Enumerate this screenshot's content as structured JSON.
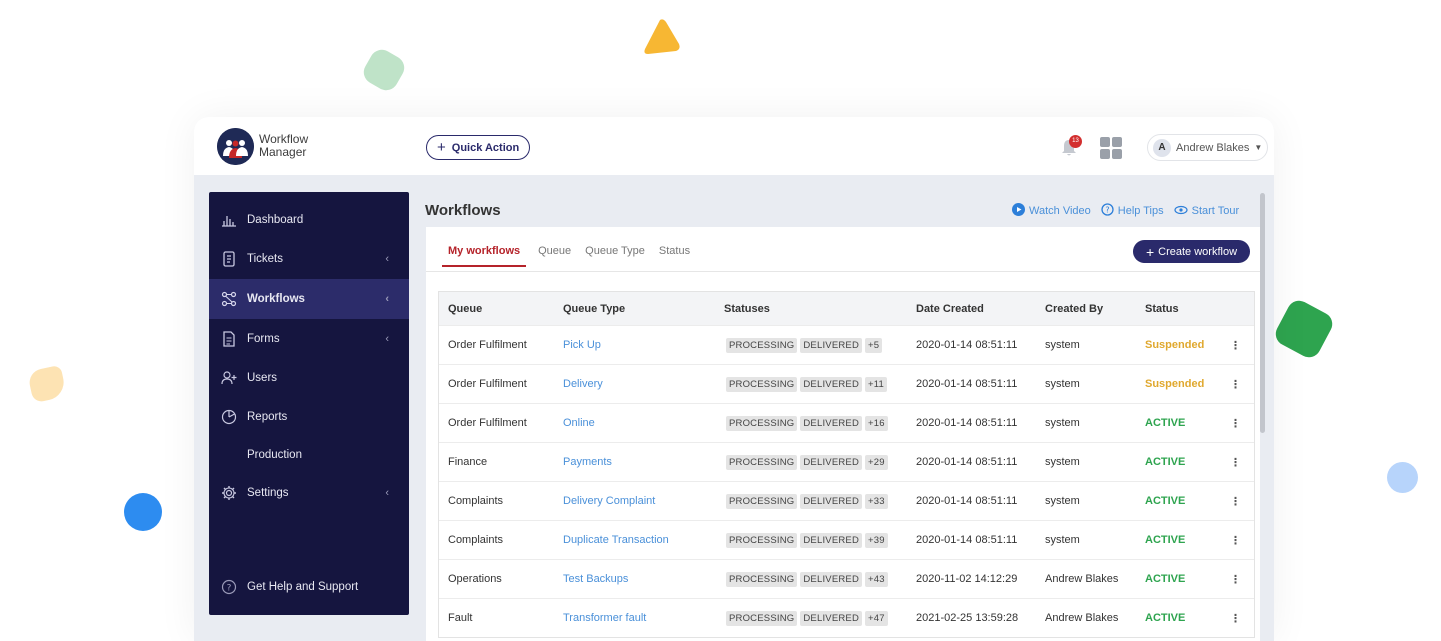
{
  "app": {
    "logo_line1": "Workflow",
    "logo_line2": "Manager",
    "quick_action_label": "Quick Action",
    "notification_count": "13",
    "user_name": "Andrew Blakes",
    "user_initial": "A"
  },
  "sidebar": {
    "items": [
      {
        "label": "Dashboard",
        "icon": "bar-chart-icon"
      },
      {
        "label": "Tickets",
        "icon": "ticket-icon"
      },
      {
        "label": "Workflows",
        "icon": "workflow-icon"
      },
      {
        "label": "Forms",
        "icon": "form-icon"
      },
      {
        "label": "Users",
        "icon": "users-icon"
      },
      {
        "label": "Reports",
        "icon": "pie-chart-icon"
      },
      {
        "label": "Production",
        "icon": ""
      },
      {
        "label": "Settings",
        "icon": "gear-icon"
      },
      {
        "label": "Get Help and Support",
        "icon": "help-icon"
      }
    ]
  },
  "main": {
    "title": "Workflows",
    "help_links": {
      "watch_video": "Watch Video",
      "help_tips": "Help Tips",
      "start_tour": "Start Tour"
    },
    "tabs": [
      "My workflows",
      "Queue",
      "Queue Type",
      "Status"
    ],
    "create_label": "Create workflow",
    "table": {
      "headers": [
        "Queue",
        "Queue Type",
        "Statuses",
        "Date Created",
        "Created By",
        "Status"
      ],
      "rows": [
        {
          "queue": "Order Fulfilment",
          "queue_type": "Pick Up",
          "s1": "PROCESSING",
          "s2": "DELIVERED",
          "more": "+5",
          "date": "2020-01-14 08:51:11",
          "by": "system",
          "status": "Suspended"
        },
        {
          "queue": "Order Fulfilment",
          "queue_type": "Delivery",
          "s1": "PROCESSING",
          "s2": "DELIVERED",
          "more": "+11",
          "date": "2020-01-14 08:51:11",
          "by": "system",
          "status": "Suspended"
        },
        {
          "queue": "Order Fulfilment",
          "queue_type": "Online",
          "s1": "PROCESSING",
          "s2": "DELIVERED",
          "more": "+16",
          "date": "2020-01-14 08:51:11",
          "by": "system",
          "status": "ACTIVE"
        },
        {
          "queue": "Finance",
          "queue_type": "Payments",
          "s1": "PROCESSING",
          "s2": "DELIVERED",
          "more": "+29",
          "date": "2020-01-14 08:51:11",
          "by": "system",
          "status": "ACTIVE"
        },
        {
          "queue": "Complaints",
          "queue_type": "Delivery Complaint",
          "s1": "PROCESSING",
          "s2": "DELIVERED",
          "more": "+33",
          "date": "2020-01-14 08:51:11",
          "by": "system",
          "status": "ACTIVE"
        },
        {
          "queue": "Complaints",
          "queue_type": "Duplicate Transaction",
          "s1": "PROCESSING",
          "s2": "DELIVERED",
          "more": "+39",
          "date": "2020-01-14 08:51:11",
          "by": "system",
          "status": "ACTIVE"
        },
        {
          "queue": "Operations",
          "queue_type": "Test Backups",
          "s1": "PROCESSING",
          "s2": "DELIVERED",
          "more": "+43",
          "date": "2020-11-02 14:12:29",
          "by": "Andrew Blakes",
          "status": "ACTIVE"
        },
        {
          "queue": "Fault",
          "queue_type": "Transformer fault",
          "s1": "PROCESSING",
          "s2": "DELIVERED",
          "more": "+47",
          "date": "2021-02-25 13:59:28",
          "by": "Andrew Blakes",
          "status": "ACTIVE"
        }
      ]
    }
  },
  "colors": {
    "sidebar_bg": "#15153f",
    "accent_red": "#b5232a",
    "primary_navy": "#2a2a6b",
    "link_blue": "#4a90d9",
    "status_active": "#2ea44f",
    "status_suspended": "#e0a82e"
  }
}
